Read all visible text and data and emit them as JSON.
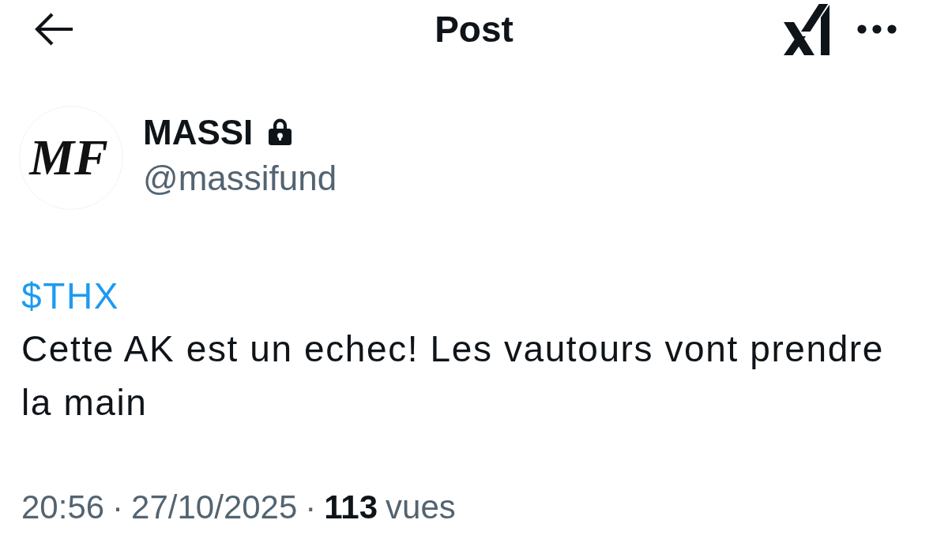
{
  "header": {
    "title": "Post"
  },
  "author": {
    "avatar_monogram": "MF",
    "name": "MASSI",
    "protected": true,
    "handle": "@massifund"
  },
  "post": {
    "lines": [
      {
        "kind": "cashtag",
        "text": "$THX"
      },
      {
        "kind": "text",
        "text": "Cette AK est un echec! Les vautours vont prendre la main"
      }
    ]
  },
  "meta": [
    {
      "kind": "time",
      "text": "20:56"
    },
    {
      "kind": "separator",
      "text": "·"
    },
    {
      "kind": "date",
      "text": "27/10/2025"
    },
    {
      "kind": "separator",
      "text": "·"
    },
    {
      "kind": "views_count",
      "text": "113"
    },
    {
      "kind": "views_label",
      "text": "vues"
    }
  ]
}
